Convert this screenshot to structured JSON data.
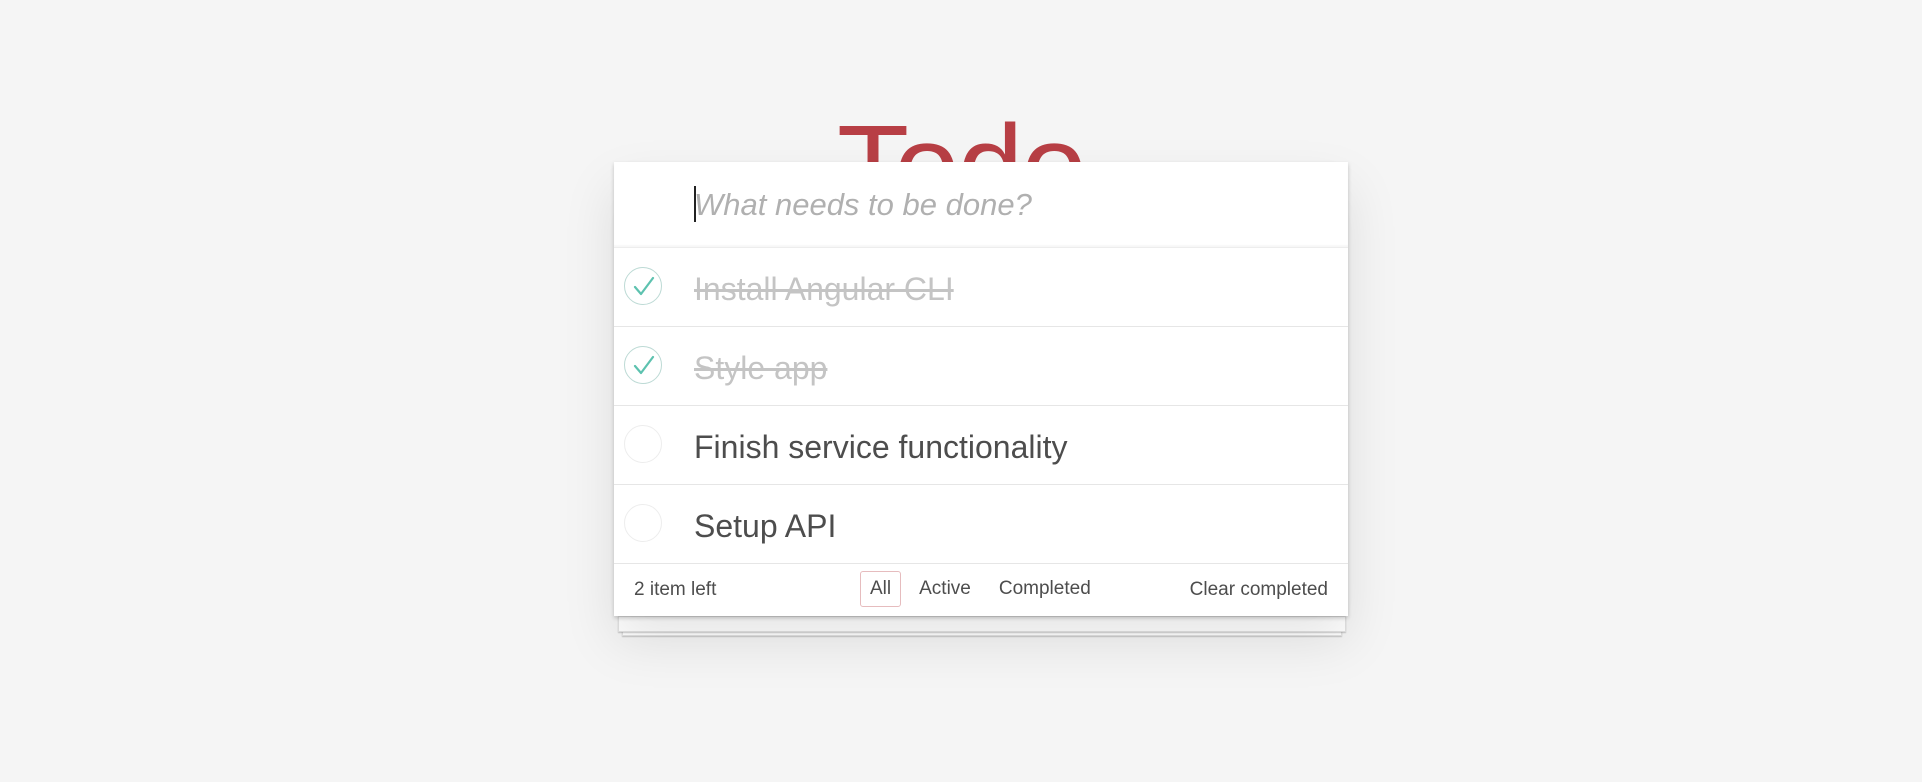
{
  "header": {
    "title": "Todo"
  },
  "new_todo": {
    "placeholder": "What needs to be done?",
    "value": ""
  },
  "todos": [
    {
      "label": "Install Angular CLI",
      "completed": true
    },
    {
      "label": "Style app",
      "completed": true
    },
    {
      "label": "Finish service functionality",
      "completed": false
    },
    {
      "label": "Setup API",
      "completed": false
    }
  ],
  "footer": {
    "count_text": "2 item left",
    "filters": [
      {
        "label": "All",
        "selected": true
      },
      {
        "label": "Active",
        "selected": false
      },
      {
        "label": "Completed",
        "selected": false
      }
    ],
    "clear_label": "Clear completed"
  },
  "colors": {
    "title": "#b83f45",
    "check": "#5dc2af",
    "background": "#f5f5f5"
  },
  "icons": {
    "completed_toggle": "checkmark-icon",
    "empty_toggle": "empty-circle-icon"
  }
}
